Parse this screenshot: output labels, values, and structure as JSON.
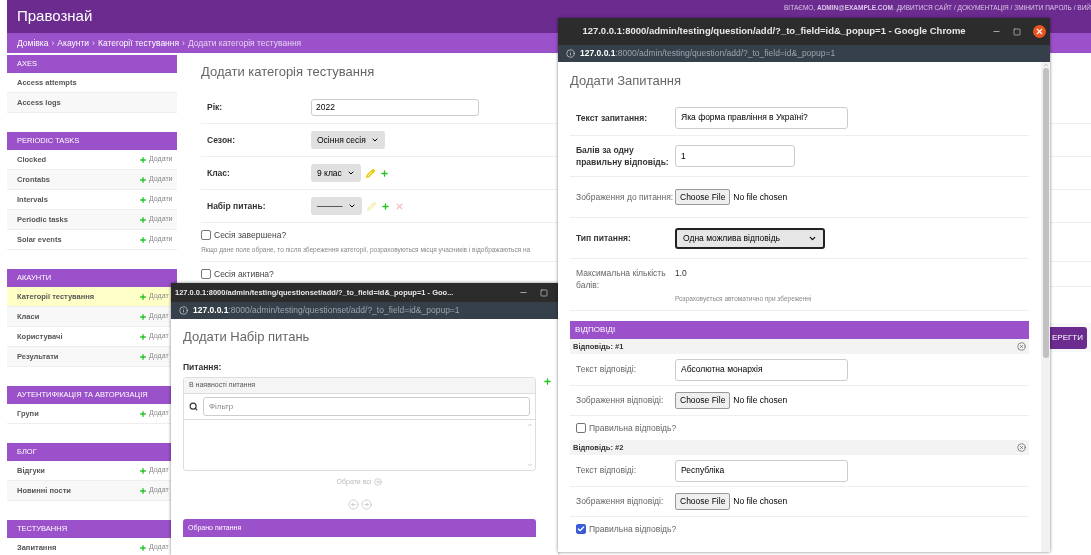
{
  "header": {
    "brand": "Правознай",
    "user_tools": "ВІТАЄМО, **ADMIN@EXAMPLE.COM**. ДИВИТИСЯ САЙТ / ДОКУМЕНТАЦІЯ / ЗМІНИТИ ПАРОЛЬ / ВИЙ"
  },
  "breadcrumbs": [
    {
      "label": "Домівка",
      "current": false
    },
    {
      "separator": "›",
      "label": "Акаунти",
      "current": false
    },
    {
      "separator": "›",
      "label": "Категорії тестування",
      "current": false
    },
    {
      "separator": "›",
      "label": "Додати категорія тестування",
      "current": true
    }
  ],
  "sidebar": {
    "modules": [
      {
        "title": "AXES",
        "items": [
          {
            "label": "Access attempts",
            "selected": false
          },
          {
            "label": "Access logs",
            "selected": false
          }
        ]
      },
      {
        "title": "PERIODIC TASKS",
        "items": [
          {
            "label": "Clocked",
            "add": "Додати",
            "selected": false
          },
          {
            "label": "Crontabs",
            "add": "Додати",
            "selected": false
          },
          {
            "label": "Intervals",
            "add": "Додати",
            "selected": false
          },
          {
            "label": "Periodic tasks",
            "add": "Додати",
            "selected": false
          },
          {
            "label": "Solar events",
            "add": "Додати",
            "selected": false
          }
        ]
      },
      {
        "title": "АКАУНТИ",
        "items": [
          {
            "label": "Категорії тестування",
            "add": "Додат",
            "selected": true
          },
          {
            "label": "Класи",
            "add": "Додат",
            "selected": false
          },
          {
            "label": "Користувачі",
            "add": "Додат",
            "selected": false
          },
          {
            "label": "Результати",
            "add": "Додат",
            "selected": false
          }
        ]
      },
      {
        "title": "АУТЕНТИФІКАЦІЯ ТА АВТОРИЗАЦІЯ",
        "items": [
          {
            "label": "Групи",
            "add": "Додат",
            "selected": false
          }
        ]
      },
      {
        "title": "БЛОГ",
        "items": [
          {
            "label": "Відгуки",
            "add": "Додат",
            "selected": false
          },
          {
            "label": "Новинні пости",
            "add": "Додат",
            "selected": false
          }
        ]
      },
      {
        "title": "ТЕСТУВАННЯ",
        "items": [
          {
            "label": "Запитання",
            "add": "Додат",
            "selected": false
          }
        ]
      }
    ]
  },
  "main": {
    "title": "Додати категорія тестування",
    "rows": [
      {
        "kind": "input",
        "label": "Рік:",
        "value": "2022"
      },
      {
        "kind": "select",
        "label": "Сезон:",
        "value": "Осіння сесія"
      },
      {
        "kind": "select",
        "label": "Клас:",
        "value": "9 клас",
        "actions": [
          {
            "kind": "edit",
            "disabled": false
          },
          {
            "kind": "add",
            "disabled": false
          }
        ]
      },
      {
        "kind": "select",
        "label": "Набір питань:",
        "value": "———",
        "actions": [
          {
            "kind": "edit",
            "disabled": true
          },
          {
            "kind": "add",
            "disabled": false
          },
          {
            "kind": "delete",
            "disabled": true
          }
        ]
      },
      {
        "kind": "checkbox",
        "label": "Сесія завершена?",
        "checked": false,
        "help": "Якщо дане поле обране, то після збереження категорії, розраховуються місця учасників і відображаються на"
      },
      {
        "kind": "checkbox",
        "label": "Сесія активна?",
        "checked": false
      }
    ],
    "save_button": "ЕРЕГТИ"
  },
  "question_popup": {
    "title": "127.0.0.1:8000/admin/testing/question/add/?_to_field=id&_popup=1 - Google Chrome",
    "address": "**127.0.0.1**:8000/admin/testing/question/add/?_to_field=id&_popup=1",
    "heading": "Додати Запитання",
    "fields": [
      {
        "kind": "text",
        "label": "Текст запитання:",
        "required": true,
        "value": "Яка форма правління в Україні?"
      },
      {
        "kind": "number",
        "label": "Балів за одну правильну відповідь:",
        "required": true,
        "value": "1"
      },
      {
        "kind": "file",
        "label": "Зображення до питання:",
        "required": false,
        "button": "Choose File",
        "status": "No file chosen"
      },
      {
        "kind": "select",
        "label": "Тип питання:",
        "required": true,
        "value": "Одна можлива відповідь"
      },
      {
        "kind": "readonly",
        "label": "Максимальна кількість балів:",
        "required": false,
        "value": "1.0",
        "help": "Розраховується автоматично при збереженні"
      }
    ],
    "answers_title": "ВІДПОВІДІ",
    "answers": [
      {
        "title": "Відповідь: #1",
        "text_label": "Текст відповіді:",
        "text_value": "Абсолютна монархія",
        "image_label": "Зображення відповіді:",
        "button": "Choose File",
        "status": "No file chosen",
        "correct_label": "Правильна відповідь?",
        "correct": false
      },
      {
        "title": "Відповідь: #2",
        "text_label": "Текст відповіді:",
        "text_value": "Республіка",
        "image_label": "Зображення відповіді:",
        "button": "Choose File",
        "status": "No file chosen",
        "correct_label": "Правильна відповідь?",
        "correct": true
      }
    ]
  },
  "questionset_popup": {
    "title": "127.0.0.1:8000/admin/testing/questionset/add/?_to_field=id&_popup=1 - Goo...",
    "address": "**127.0.0.1**:8000/admin/testing/questionset/add/?_to_field=id&_popup=1",
    "heading": "Додати Набір питань",
    "field_label": "Питання:",
    "available_title": "В наявності питання",
    "filter_placeholder": "Фільтр",
    "choose_all": "Обрати всі",
    "chosen_title": "Обрано питання"
  }
}
